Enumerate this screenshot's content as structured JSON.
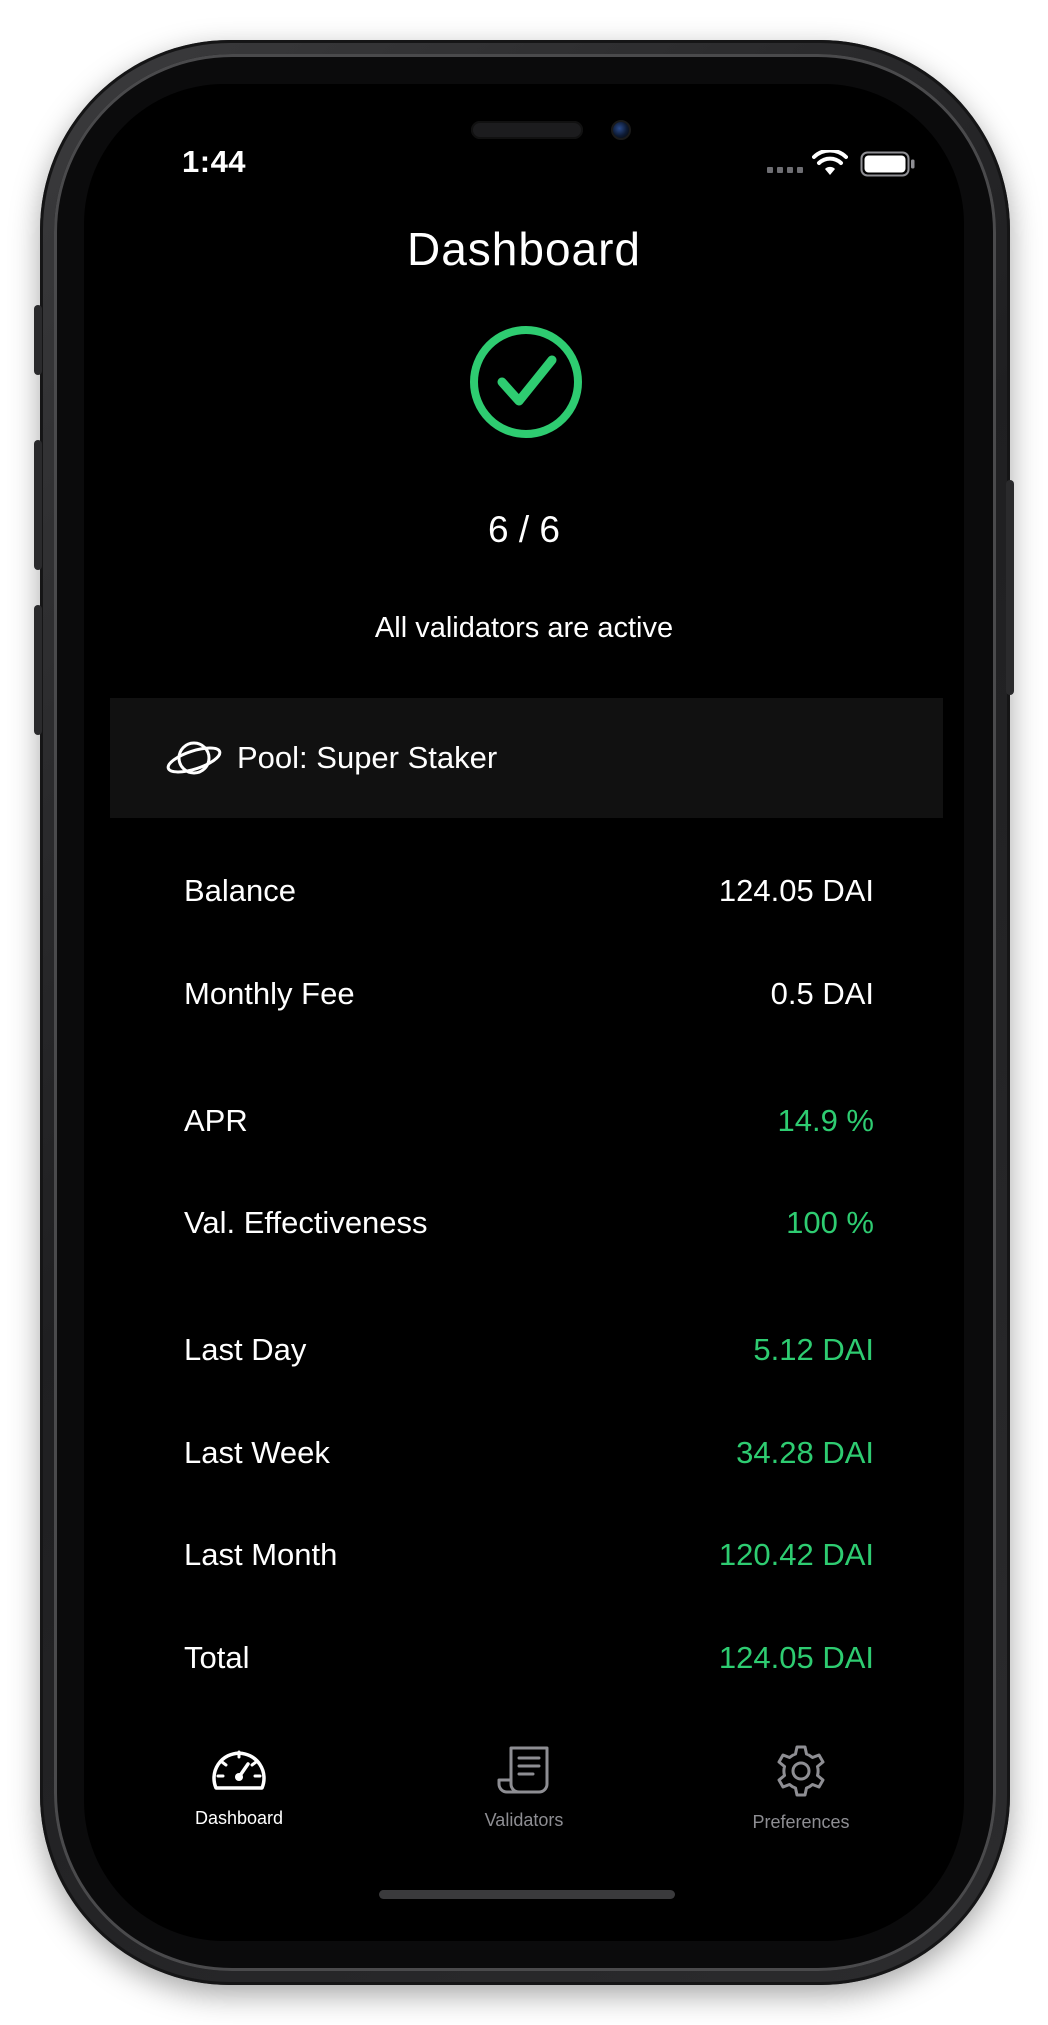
{
  "status_bar": {
    "time": "1:44"
  },
  "header": {
    "title": "Dashboard",
    "validator_count": "6 / 6",
    "status_text": "All validators are active",
    "accent_color": "#2ecc71"
  },
  "pool": {
    "label": "Pool: Super Staker",
    "icon": "planet-icon"
  },
  "stats": [
    {
      "label": "Balance",
      "value": "124.05 DAI",
      "highlight": false
    },
    {
      "label": "Monthly Fee",
      "value": "0.5 DAI",
      "highlight": false
    },
    {
      "label": "APR",
      "value": "14.9 %",
      "highlight": true
    },
    {
      "label": "Val. Effectiveness",
      "value": "100 %",
      "highlight": true
    },
    {
      "label": "Last Day",
      "value": "5.12 DAI",
      "highlight": true
    },
    {
      "label": "Last Week",
      "value": "34.28 DAI",
      "highlight": true
    },
    {
      "label": "Last Month",
      "value": "120.42 DAI",
      "highlight": true
    },
    {
      "label": "Total",
      "value": "124.05 DAI",
      "highlight": true
    }
  ],
  "tabs": [
    {
      "label": "Dashboard",
      "icon": "speedometer-icon",
      "active": true
    },
    {
      "label": "Validators",
      "icon": "receipt-icon",
      "active": false
    },
    {
      "label": "Preferences",
      "icon": "gear-icon",
      "active": false
    }
  ]
}
